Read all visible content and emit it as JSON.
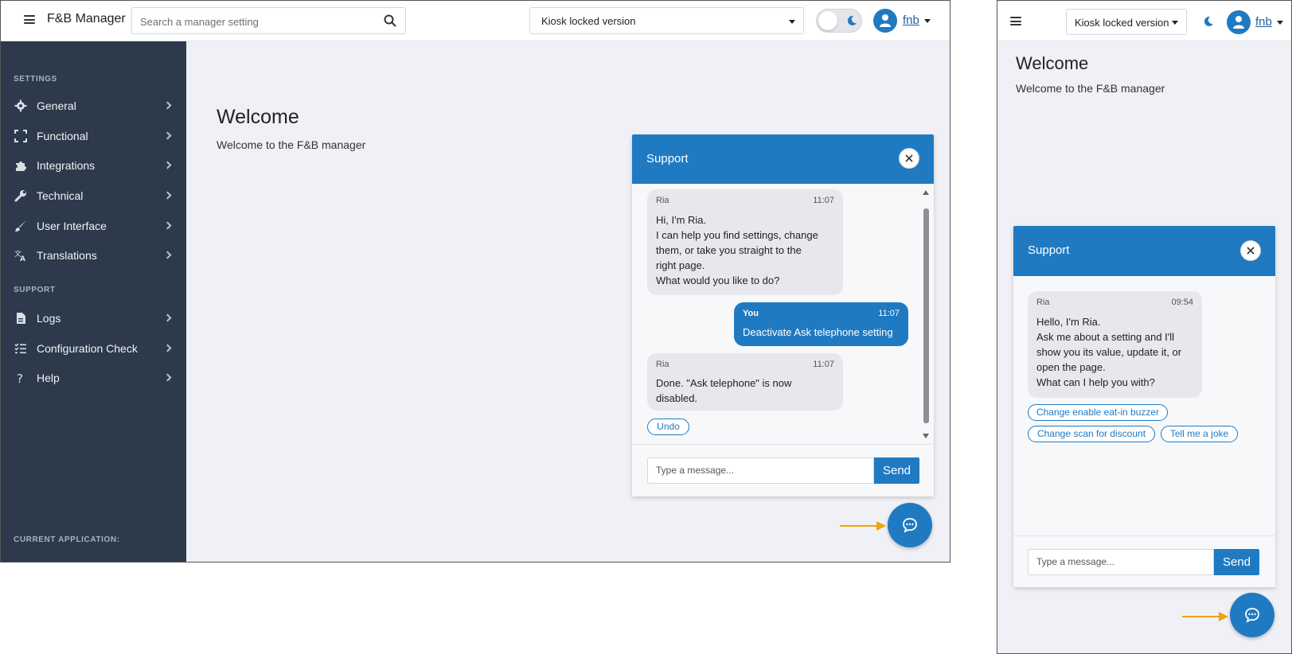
{
  "desktop": {
    "app_title": "F&B Manager",
    "search_placeholder": "Search a manager setting",
    "version_select": "Kiosk locked version",
    "user_name": "fnb",
    "sidebar": {
      "settings_heading": "SETTINGS",
      "settings_items": [
        {
          "label": "General",
          "icon": "gear-icon"
        },
        {
          "label": "Functional",
          "icon": "expand-icon"
        },
        {
          "label": "Integrations",
          "icon": "puzzle-icon"
        },
        {
          "label": "Technical",
          "icon": "wrench-icon"
        },
        {
          "label": "User Interface",
          "icon": "brush-icon"
        },
        {
          "label": "Translations",
          "icon": "translate-icon"
        }
      ],
      "support_heading": "SUPPORT",
      "support_items": [
        {
          "label": "Logs",
          "icon": "file-icon"
        },
        {
          "label": "Configuration Check",
          "icon": "checklist-icon"
        },
        {
          "label": "Help",
          "icon": "question-icon"
        }
      ],
      "footer_heading": "CURRENT APPLICATION:"
    },
    "welcome_title": "Welcome",
    "welcome_sub": "Welcome to the F&B manager",
    "support": {
      "title": "Support",
      "messages": [
        {
          "sender": "Ria",
          "time": "11:07",
          "lines": [
            "Hi, I'm Ria.",
            "I can help you find settings, change",
            "them, or take you straight to the",
            "right page.",
            "What would you like to do?"
          ]
        },
        {
          "sender": "You",
          "time": "11:07",
          "lines": [
            "Deactivate Ask telephone setting"
          ]
        },
        {
          "sender": "Ria",
          "time": "11:07",
          "lines": [
            "Done. \"Ask telephone\" is now",
            "disabled."
          ]
        }
      ],
      "undo_label": "Undo",
      "input_placeholder": "Type a message...",
      "send_label": "Send"
    }
  },
  "mobile": {
    "version_select": "Kiosk locked version",
    "user_name": "fnb",
    "welcome_title": "Welcome",
    "welcome_sub": "Welcome to the F&B manager",
    "support": {
      "title": "Support",
      "message": {
        "sender": "Ria",
        "time": "09:54",
        "lines": [
          "Hello, I'm Ria.",
          "Ask me about a setting and I'll",
          "show you its value, update it, or",
          "open the page.",
          "What can I help you with?"
        ]
      },
      "suggestions": [
        "Change enable eat-in buzzer",
        "Change scan for discount",
        "Tell me a joke"
      ],
      "input_placeholder": "Type a message...",
      "send_label": "Send"
    }
  },
  "colors": {
    "accent": "#1f7ac2",
    "sidebar": "#2c3a4b",
    "annotation_arrow": "#f0a30a",
    "background": "#f0f1f6"
  }
}
